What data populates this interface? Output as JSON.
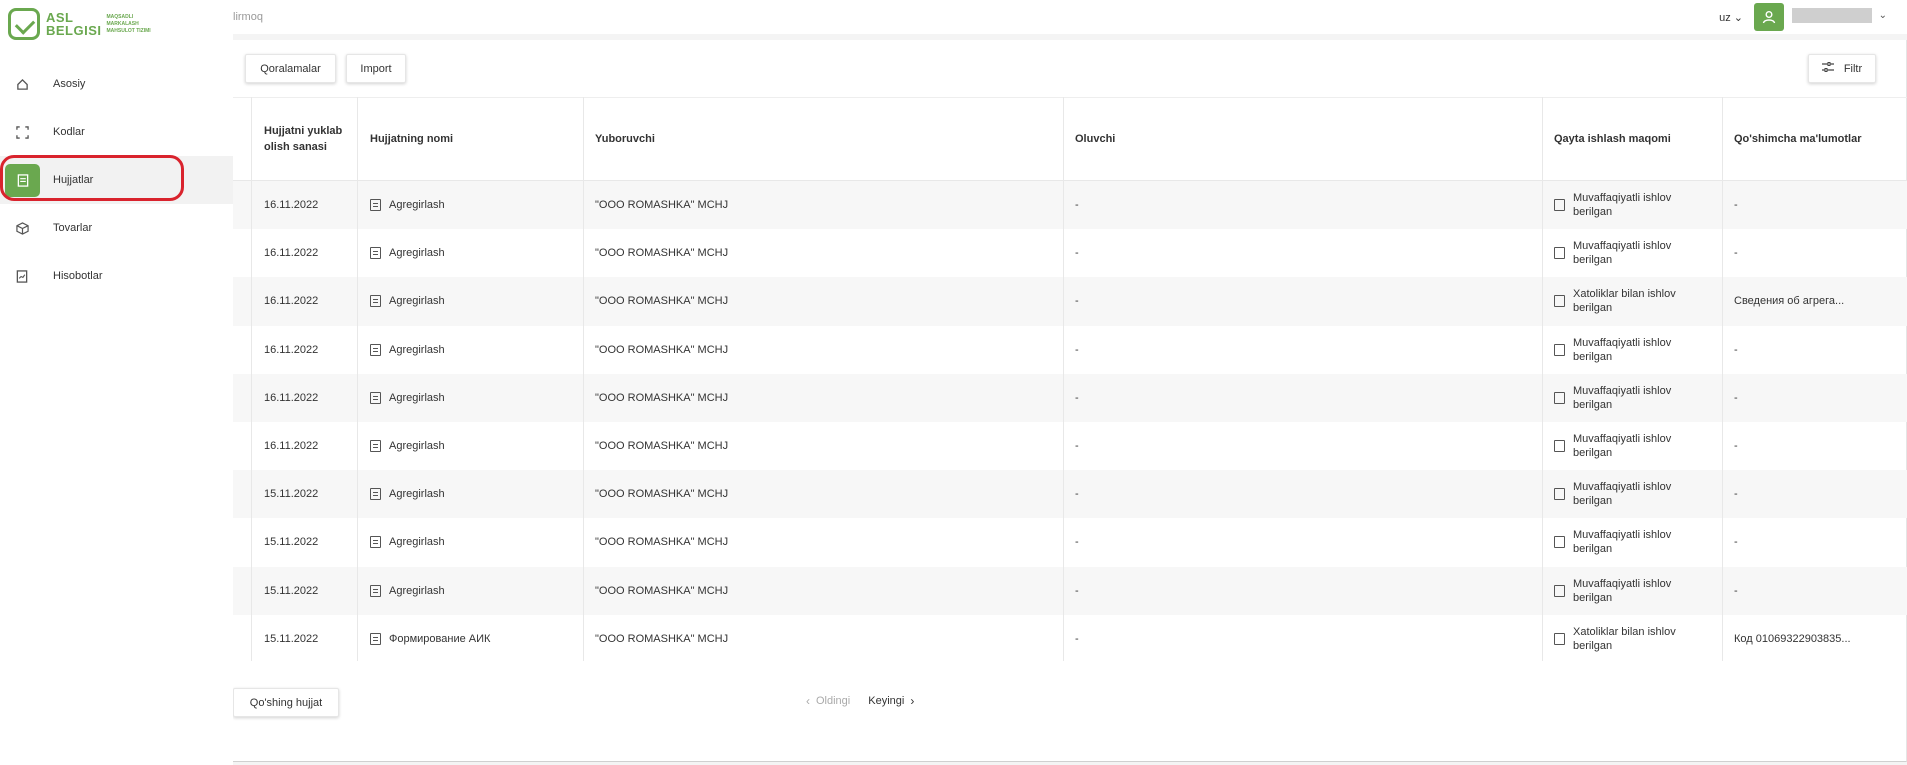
{
  "brand": {
    "name_line1": "ASL",
    "name_line2": "BELGISI",
    "tag_line1": "MAQSADLI",
    "tag_line2": "MARKALASH",
    "tag_line3": "MAHSULOT TIZIMI"
  },
  "header": {
    "breadcrumb": "lirmoq",
    "language": "uz"
  },
  "sidebar": {
    "items": [
      {
        "label": "Asosiy",
        "icon": "home-icon"
      },
      {
        "label": "Kodlar",
        "icon": "scan-icon"
      },
      {
        "label": "Hujjatlar",
        "icon": "document-icon",
        "active": true
      },
      {
        "label": "Tovarlar",
        "icon": "box-icon"
      },
      {
        "label": "Hisobotlar",
        "icon": "report-icon"
      }
    ]
  },
  "toolbar": {
    "templates_label": "Qoralamalar",
    "import_label": "Import",
    "filter_label": "Filtr"
  },
  "table": {
    "columns": [
      "Hujjatni yuklab olish sanasi",
      "Hujjatning nomi",
      "Yuboruvchi",
      "Oluvchi",
      "Qayta ishlash maqomi",
      "Qo'shimcha ma'lumotlar"
    ],
    "rows": [
      {
        "date": "16.11.2022",
        "name": "Agregirlash",
        "sender": "\"OOO ROMASHKA\" MCHJ",
        "receiver": "-",
        "status": "Muvaffaqiyatli ishlov berilgan",
        "extra": "-"
      },
      {
        "date": "16.11.2022",
        "name": "Agregirlash",
        "sender": "\"OOO ROMASHKA\" MCHJ",
        "receiver": "-",
        "status": "Muvaffaqiyatli ishlov berilgan",
        "extra": "-"
      },
      {
        "date": "16.11.2022",
        "name": "Agregirlash",
        "sender": "\"OOO ROMASHKA\" MCHJ",
        "receiver": "-",
        "status": "Xatoliklar bilan ishlov berilgan",
        "extra": "Сведения об агрега..."
      },
      {
        "date": "16.11.2022",
        "name": "Agregirlash",
        "sender": "\"OOO ROMASHKA\" MCHJ",
        "receiver": "-",
        "status": "Muvaffaqiyatli ishlov berilgan",
        "extra": "-"
      },
      {
        "date": "16.11.2022",
        "name": "Agregirlash",
        "sender": "\"OOO ROMASHKA\" MCHJ",
        "receiver": "-",
        "status": "Muvaffaqiyatli ishlov berilgan",
        "extra": "-"
      },
      {
        "date": "16.11.2022",
        "name": "Agregirlash",
        "sender": "\"OOO ROMASHKA\" MCHJ",
        "receiver": "-",
        "status": "Muvaffaqiyatli ishlov berilgan",
        "extra": "-"
      },
      {
        "date": "15.11.2022",
        "name": "Agregirlash",
        "sender": "\"OOO ROMASHKA\" MCHJ",
        "receiver": "-",
        "status": "Muvaffaqiyatli ishlov berilgan",
        "extra": "-"
      },
      {
        "date": "15.11.2022",
        "name": "Agregirlash",
        "sender": "\"OOO ROMASHKA\" MCHJ",
        "receiver": "-",
        "status": "Muvaffaqiyatli ishlov berilgan",
        "extra": "-"
      },
      {
        "date": "15.11.2022",
        "name": "Agregirlash",
        "sender": "\"OOO ROMASHKA\" MCHJ",
        "receiver": "-",
        "status": "Muvaffaqiyatli ishlov berilgan",
        "extra": "-"
      },
      {
        "date": "15.11.2022",
        "name": "Формирование АИК",
        "sender": "\"OOO ROMASHKA\" MCHJ",
        "receiver": "-",
        "status": "Xatoliklar bilan ishlov berilgan",
        "extra": "Код 01069322903835..."
      }
    ]
  },
  "footer": {
    "add_label": "Qo'shing hujjat",
    "prev_label": "Oldingi",
    "next_label": "Keyingi"
  },
  "colors": {
    "accent": "#6aa84f",
    "highlight": "#d9232d"
  }
}
